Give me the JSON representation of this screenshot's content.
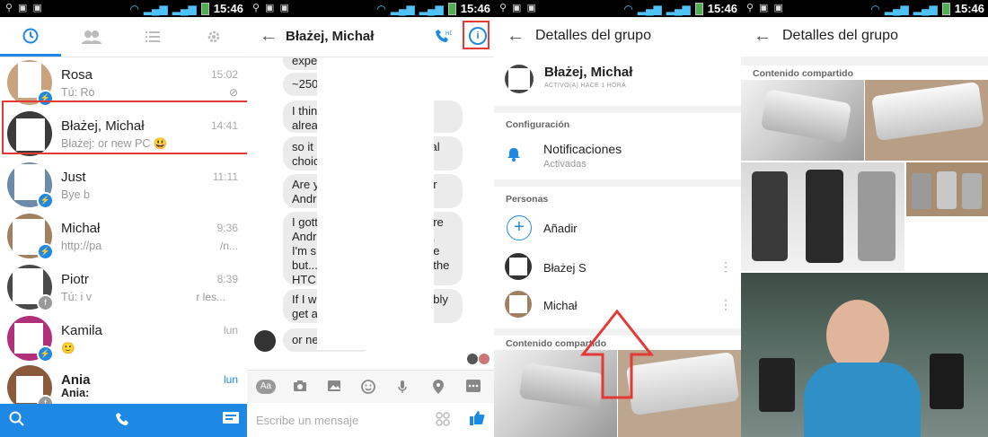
{
  "status": {
    "time": "15:46"
  },
  "panel1": {
    "chats": [
      {
        "name": "Rosa",
        "time": "15:02",
        "preview": "Tú: Ro",
        "extra": "⊘"
      },
      {
        "name": "Błażej, Michał",
        "time": "14:41",
        "preview": "Błażej: or new PC 😃",
        "extra": ""
      },
      {
        "name": "Just",
        "time": "11:11",
        "preview": "Bye b",
        "extra": ""
      },
      {
        "name": "Michał",
        "time": "9:36",
        "preview": "http://pa",
        "extra": "/n..."
      },
      {
        "name": "Piotr",
        "time": "8:39",
        "preview": "Tú: i v",
        "extra": "r les..."
      },
      {
        "name": "Kamila",
        "time": "lun",
        "preview": "🙂",
        "extra": ""
      },
      {
        "name": "Ania",
        "time": "lun",
        "preview": "Ania:",
        "extra": ""
      }
    ]
  },
  "panel2": {
    "title": "Błażej, Michał",
    "messages": [
      "expensive",
      "~250",
      "I thin\nalrea",
      "so it\nchoic",
      "Are y\nAndr",
      "I gott\nAndr\nI'm s\nbut...\nHTC",
      "If I w\nget a",
      "or ne"
    ],
    "messages_right": [
      "onal",
      "or",
      "are\nll,\nne\nf the",
      "ably"
    ],
    "composer_placeholder": "Escribe un mensaje"
  },
  "panel3": {
    "title": "Detalles del grupo",
    "group_name": "Błażej, Michał",
    "group_status": "ACTIVO(A) HACE 1 HORA",
    "section_config": "Configuración",
    "notif_title": "Notificaciones",
    "notif_sub": "Activadas",
    "section_people": "Personas",
    "add_label": "Añadir",
    "people": [
      "Błażej S",
      "Michał"
    ],
    "section_shared": "Contenido compartido"
  },
  "panel4": {
    "title": "Detalles del grupo",
    "section_shared": "Contenido compartido"
  }
}
